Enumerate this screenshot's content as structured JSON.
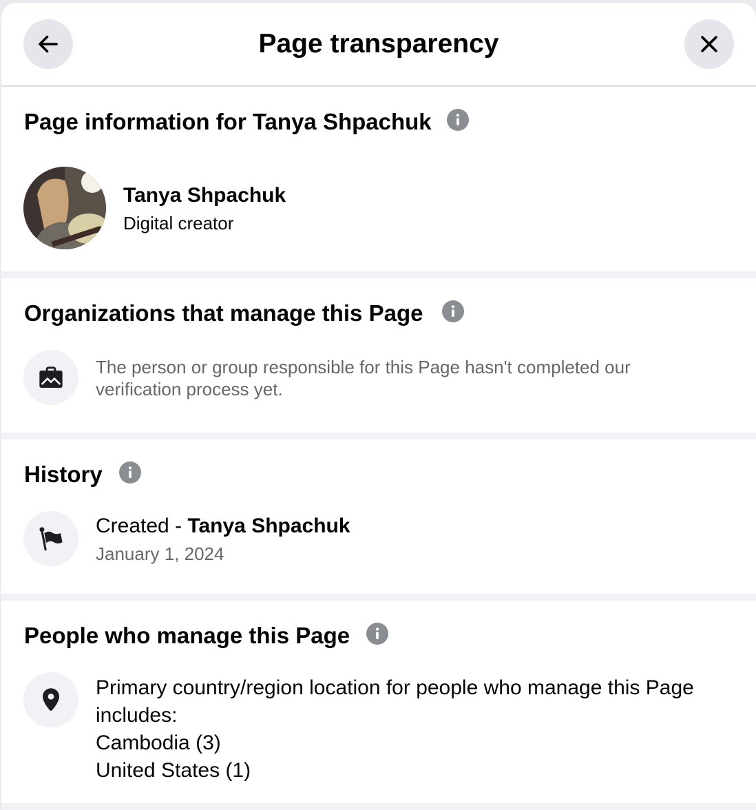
{
  "header": {
    "title": "Page transparency",
    "back_icon": "arrow-left-icon",
    "close_icon": "close-icon"
  },
  "page_info": {
    "title": "Page information for Tanya Shpachuk",
    "name": "Tanya Shpachuk",
    "category": "Digital creator"
  },
  "organizations": {
    "title": "Organizations that manage this Page",
    "icon": "briefcase-icon",
    "text": "The person or group responsible for this Page hasn't completed our verification process yet."
  },
  "history": {
    "title": "History",
    "icon": "flag-icon",
    "event_prefix": "Created - ",
    "event_name": "Tanya Shpachuk",
    "date": "January 1, 2024"
  },
  "people": {
    "title": "People who manage this Page",
    "icon": "location-pin-icon",
    "intro": "Primary country/region location for people who manage this Page includes:",
    "countries": [
      "Cambodia (3)",
      "United States (1)"
    ]
  },
  "colors": {
    "primary_text": "#050505",
    "secondary_text": "#65676b",
    "button_bg": "#e4e6eb",
    "icon_bg": "#f0f2f5",
    "info_icon": "#8a8d91"
  }
}
